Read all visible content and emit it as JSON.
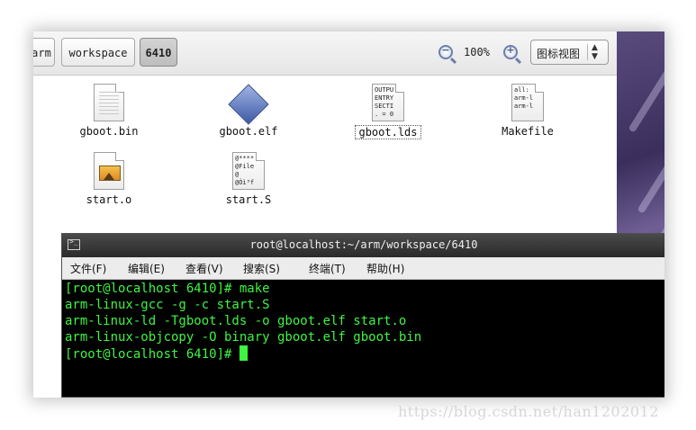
{
  "breadcrumbs": [
    {
      "label": "arm",
      "active": false
    },
    {
      "label": "workspace",
      "active": false
    },
    {
      "label": "6410",
      "active": true
    }
  ],
  "zoom": {
    "zoom_out_icon": "minus-magnifier-icon",
    "zoom_in_icon": "plus-magnifier-icon",
    "level": "100%"
  },
  "view_selector": {
    "label": "图标视图"
  },
  "files": [
    {
      "name": "gboot.bin",
      "icon": "binary-file-icon",
      "selected": false,
      "preview": ""
    },
    {
      "name": "gboot.elf",
      "icon": "executable-file-icon",
      "selected": false,
      "preview": ""
    },
    {
      "name": "gboot.lds",
      "icon": "text-file-icon",
      "selected": true,
      "preview": "OUTPU\nENTRY\nSECTI\n. = 0"
    },
    {
      "name": "Makefile",
      "icon": "text-file-icon",
      "selected": false,
      "preview": "all:\narm-l\narm-l"
    },
    {
      "name": "start.o",
      "icon": "object-file-icon",
      "selected": false,
      "preview": ""
    },
    {
      "name": "start.S",
      "icon": "source-file-icon",
      "selected": false,
      "preview": "@****\n@File\n@\n@Òì³f"
    }
  ],
  "terminal": {
    "title": "root@localhost:~/arm/workspace/6410",
    "menu": [
      "文件(F)",
      "编辑(E)",
      "查看(V)",
      "搜索(S)",
      "终端(T)",
      "帮助(H)"
    ],
    "lines": [
      "[root@localhost 6410]# make",
      "arm-linux-gcc -g -c start.S",
      "arm-linux-ld -Tgboot.lds -o gboot.elf start.o",
      "arm-linux-objcopy -O binary gboot.elf gboot.bin"
    ],
    "prompt": "[root@localhost 6410]# "
  },
  "watermark": "https://blog.csdn.net/han1202012",
  "colors": {
    "terminal_text": "#3ef542",
    "terminal_bg": "#000000",
    "desktop": "#3b2e5c"
  }
}
